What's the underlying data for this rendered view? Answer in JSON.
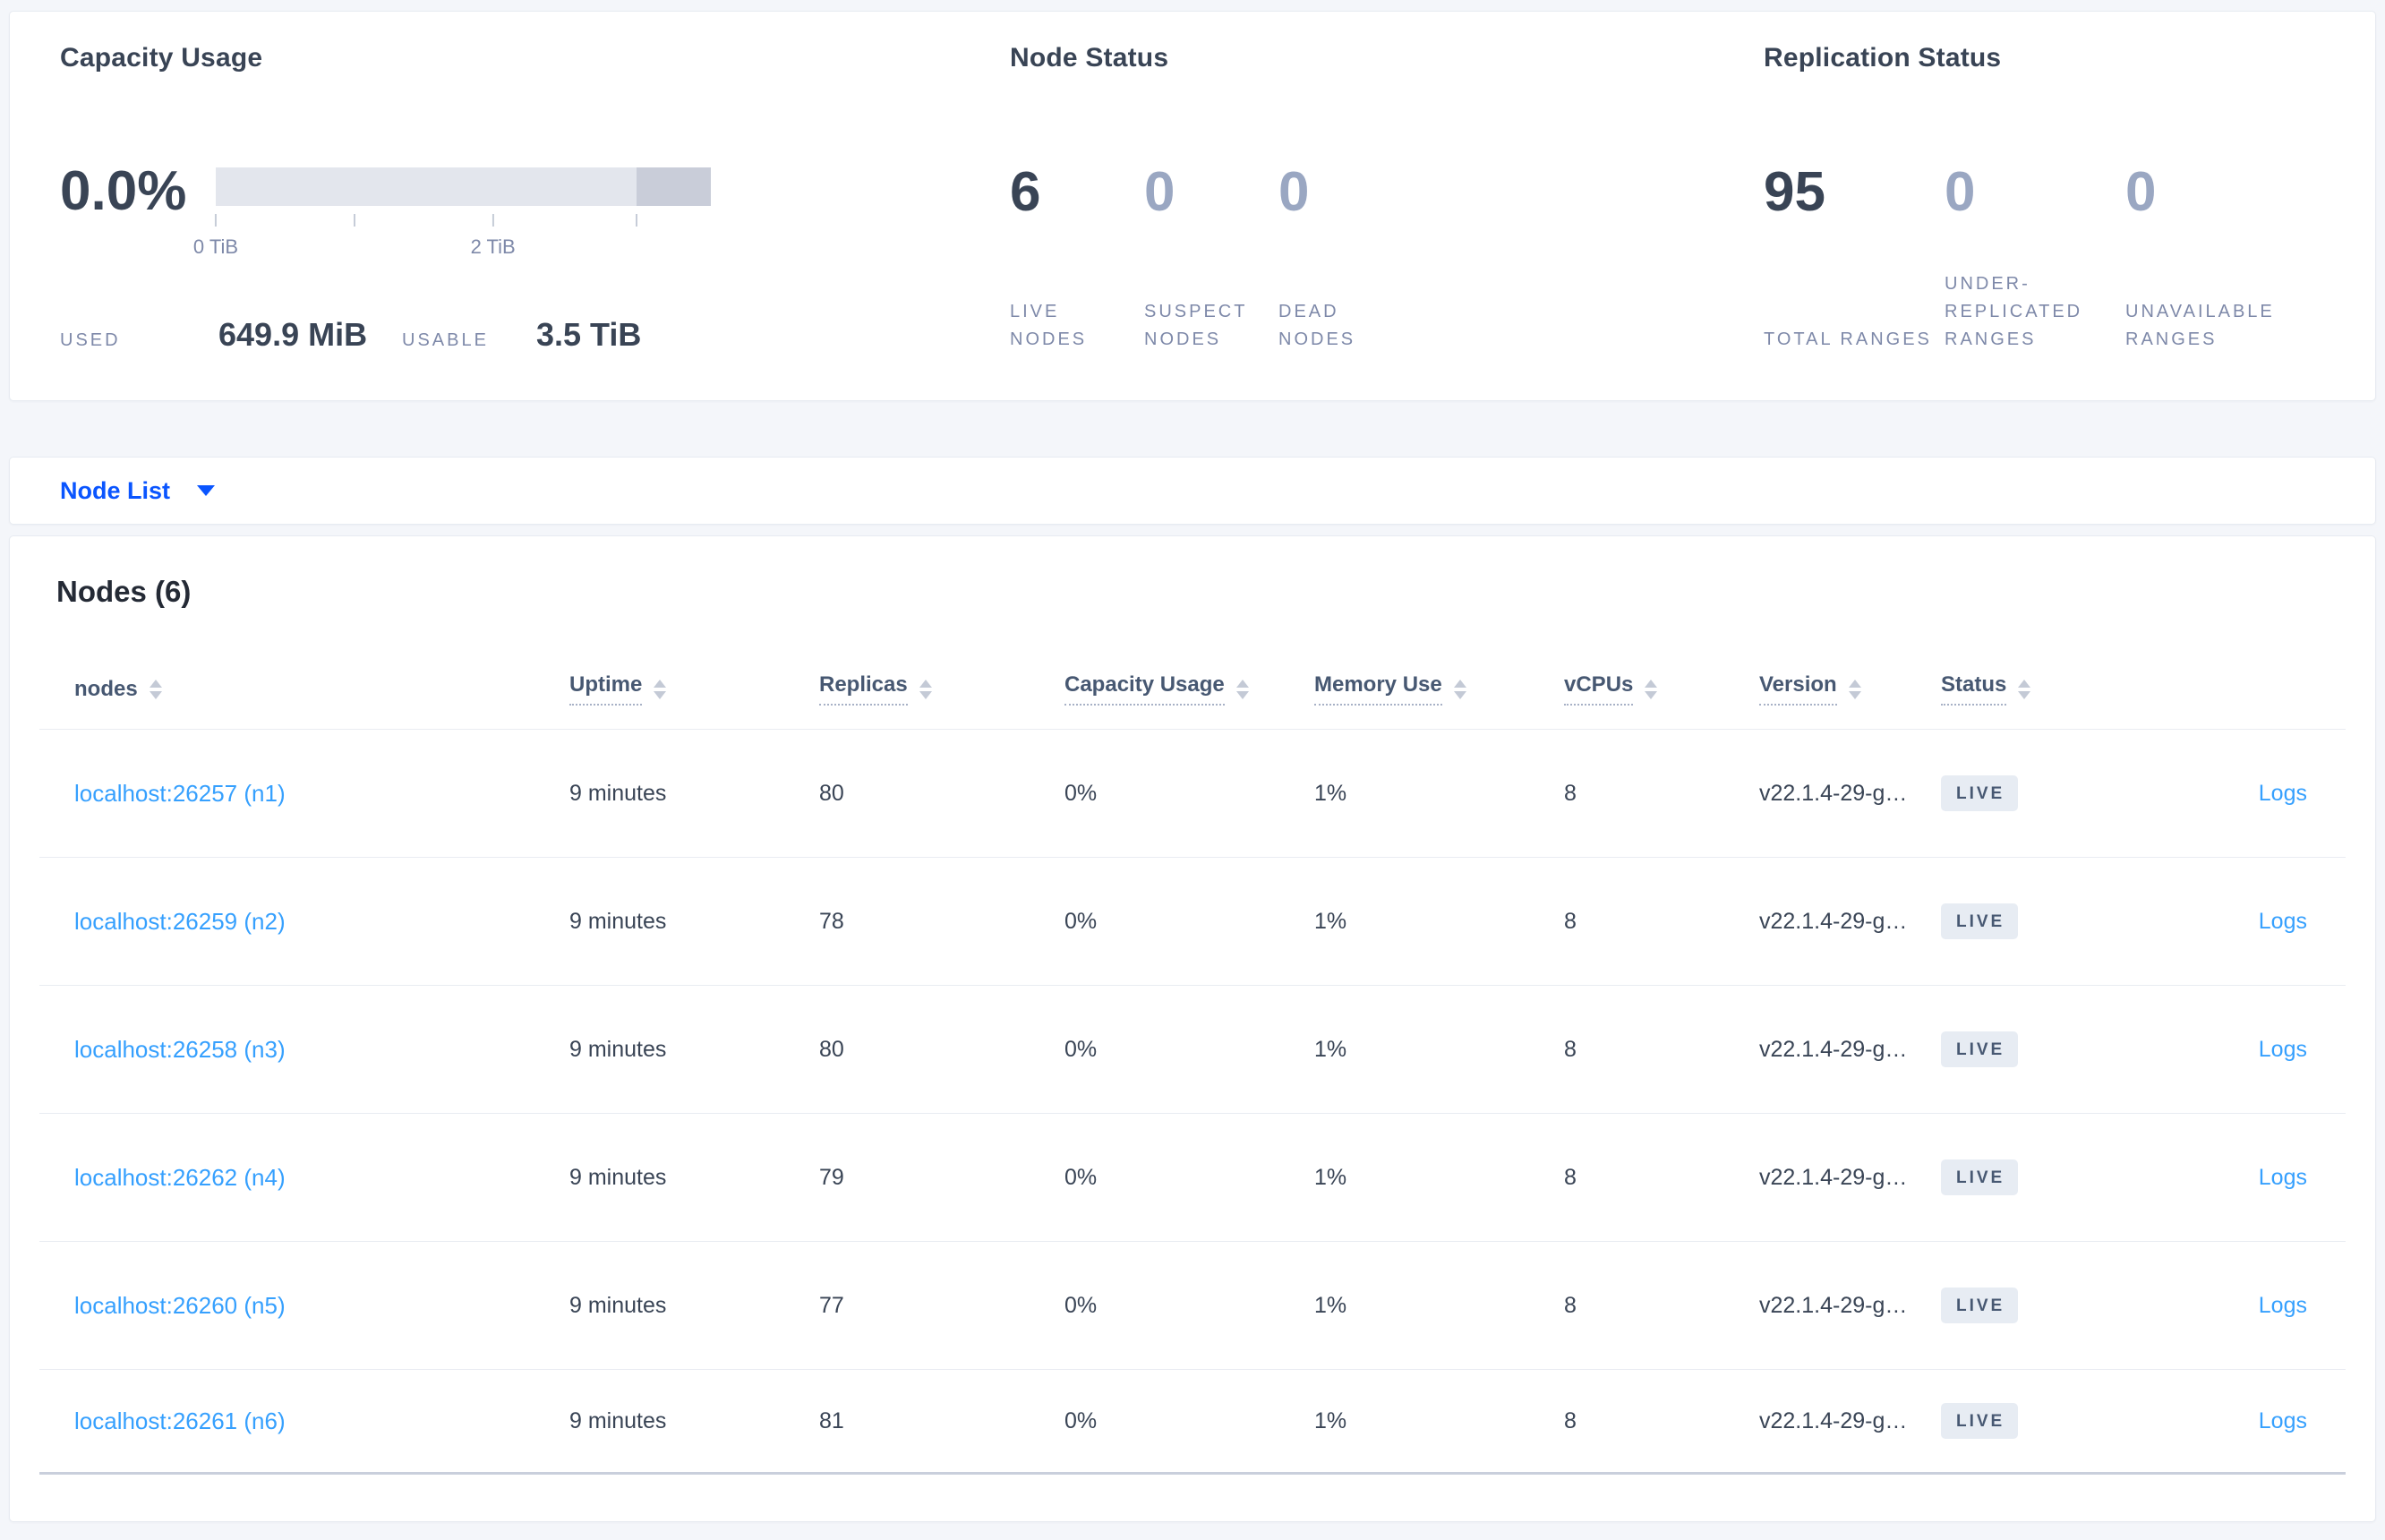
{
  "colors": {
    "page_bg": "#f4f6fa",
    "card_bg": "#ffffff",
    "card_border": "#e7ebf1",
    "text_dark": "#394455",
    "text_heading": "#242a35",
    "text_slate": "#475872",
    "text_muted": "#7e89a9",
    "number_muted": "#9aa7c2",
    "divider": "#e9ecf2",
    "divider_strong": "#c9cfdc",
    "badge_bg": "#e7ecf3",
    "link_blue": "#36a0fe",
    "link_deep": "#0a55ff",
    "bar_light": "#e3e6ed",
    "bar_dark": "#c9cdd9",
    "sort_arrow": "#c4cad6",
    "tick_mark": "#c6ccd8",
    "dotted": "#a7b1c6"
  },
  "summary": {
    "capacity": {
      "title": "Capacity Usage",
      "percent": "0.0%",
      "used_label": "USED",
      "used_value": "649.9 MiB",
      "usable_label": "USABLE",
      "usable_value": "3.5 TiB",
      "bar": {
        "light_width": "85%",
        "dark_width": "15%",
        "ticks": [
          {
            "pos": "0%",
            "label": "0 TiB"
          },
          {
            "pos": "28%",
            "label": ""
          },
          {
            "pos": "56%",
            "label": "2 TiB"
          },
          {
            "pos": "85%",
            "label": ""
          }
        ]
      }
    },
    "node_status": {
      "title": "Node Status",
      "stats": [
        {
          "value": "6",
          "label": "LIVE NODES",
          "cls": "em"
        },
        {
          "value": "0",
          "label": "SUSPECT NODES",
          "cls": ""
        },
        {
          "value": "0",
          "label": "DEAD NODES",
          "cls": ""
        }
      ]
    },
    "replication": {
      "title": "Replication Status",
      "stats": [
        {
          "value": "95",
          "label": "TOTAL RANGES",
          "cls": "em"
        },
        {
          "value": "0",
          "label": "UNDER-REPLICATED RANGES",
          "cls": ""
        },
        {
          "value": "0",
          "label": "UNAVAILABLE RANGES",
          "cls": ""
        }
      ]
    }
  },
  "view_selector": {
    "label": "Node List"
  },
  "nodes_section": {
    "heading": "Nodes (6)",
    "columns": [
      {
        "label": "nodes",
        "underline": "",
        "hide": ""
      },
      {
        "label": "Uptime",
        "underline": "dotted",
        "hide": ""
      },
      {
        "label": "Replicas",
        "underline": "dotted",
        "hide": ""
      },
      {
        "label": "Capacity Usage",
        "underline": "dotted",
        "hide": ""
      },
      {
        "label": "Memory Use",
        "underline": "dotted",
        "hide": ""
      },
      {
        "label": "vCPUs",
        "underline": "dotted",
        "hide": ""
      },
      {
        "label": "Version",
        "underline": "dotted",
        "hide": ""
      },
      {
        "label": "Status",
        "underline": "dotted",
        "hide": ""
      },
      {
        "label": "",
        "underline": "",
        "hide": "hidden"
      }
    ],
    "rows": [
      {
        "node": "localhost:26257 (n1)",
        "uptime": "9 minutes",
        "replicas": "80",
        "capacity": "0%",
        "memory": "1%",
        "vcpus": "8",
        "version": "v22.1.4-29-g…",
        "status": "LIVE",
        "logs": "Logs"
      },
      {
        "node": "localhost:26259 (n2)",
        "uptime": "9 minutes",
        "replicas": "78",
        "capacity": "0%",
        "memory": "1%",
        "vcpus": "8",
        "version": "v22.1.4-29-g…",
        "status": "LIVE",
        "logs": "Logs"
      },
      {
        "node": "localhost:26258 (n3)",
        "uptime": "9 minutes",
        "replicas": "80",
        "capacity": "0%",
        "memory": "1%",
        "vcpus": "8",
        "version": "v22.1.4-29-g…",
        "status": "LIVE",
        "logs": "Logs"
      },
      {
        "node": "localhost:26262 (n4)",
        "uptime": "9 minutes",
        "replicas": "79",
        "capacity": "0%",
        "memory": "1%",
        "vcpus": "8",
        "version": "v22.1.4-29-g…",
        "status": "LIVE",
        "logs": "Logs"
      },
      {
        "node": "localhost:26260 (n5)",
        "uptime": "9 minutes",
        "replicas": "77",
        "capacity": "0%",
        "memory": "1%",
        "vcpus": "8",
        "version": "v22.1.4-29-g…",
        "status": "LIVE",
        "logs": "Logs"
      },
      {
        "node": "localhost:26261 (n6)",
        "uptime": "9 minutes",
        "replicas": "81",
        "capacity": "0%",
        "memory": "1%",
        "vcpus": "8",
        "version": "v22.1.4-29-g…",
        "status": "LIVE",
        "logs": "Logs"
      }
    ]
  }
}
